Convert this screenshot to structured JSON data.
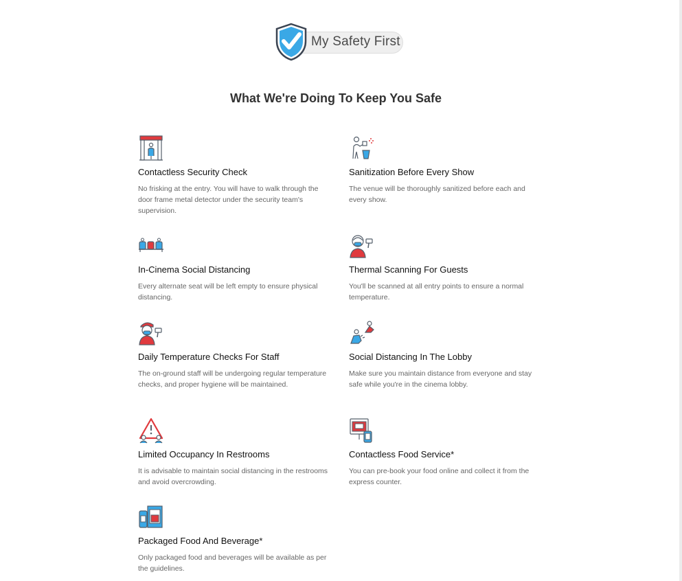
{
  "brand": {
    "name": "My Safety First"
  },
  "page_title": "What We're Doing To Keep You Safe",
  "features": [
    {
      "title": "Contactless Security Check",
      "description": "No frisking at the entry. You will have to walk through the door frame metal detector under the security team's supervision.",
      "icon": "metal-detector-icon"
    },
    {
      "title": "Sanitization Before Every Show",
      "description": "The venue will be thoroughly sanitized before each and every show.",
      "icon": "sanitizer-spray-icon"
    },
    {
      "title": "In-Cinema Social Distancing",
      "description": "Every alternate seat will be left empty to ensure physical distancing.",
      "icon": "cinema-seats-icon"
    },
    {
      "title": "Thermal Scanning For Guests",
      "description": "You'll be scanned at all entry points to ensure a normal temperature.",
      "icon": "thermal-scanner-icon"
    },
    {
      "title": "Daily Temperature Checks For Staff",
      "description": "The on-ground staff will be undergoing regular temperature checks, and proper hygiene will be maintained.",
      "icon": "staff-temperature-icon"
    },
    {
      "title": "Social Distancing In The Lobby",
      "description": "Make sure you maintain distance from everyone and stay safe while you're in the cinema lobby.",
      "icon": "lobby-distancing-icon"
    },
    {
      "title": "Limited Occupancy In Restrooms",
      "description": "It is advisable to maintain social distancing in the restrooms and avoid overcrowding.",
      "icon": "restroom-warning-icon"
    },
    {
      "title": "Contactless Food Service*",
      "description": "You can pre-book your food online and collect it from the express counter.",
      "icon": "food-order-icon"
    },
    {
      "title": "Packaged Food And Beverage*",
      "description": "Only packaged food and beverages will be available as per the guidelines.",
      "icon": "packaged-food-icon"
    }
  ],
  "colors": {
    "accent_blue": "#3aa8e6",
    "accent_red": "#e03a3e",
    "outline": "#555f6b",
    "title": "#333333"
  }
}
